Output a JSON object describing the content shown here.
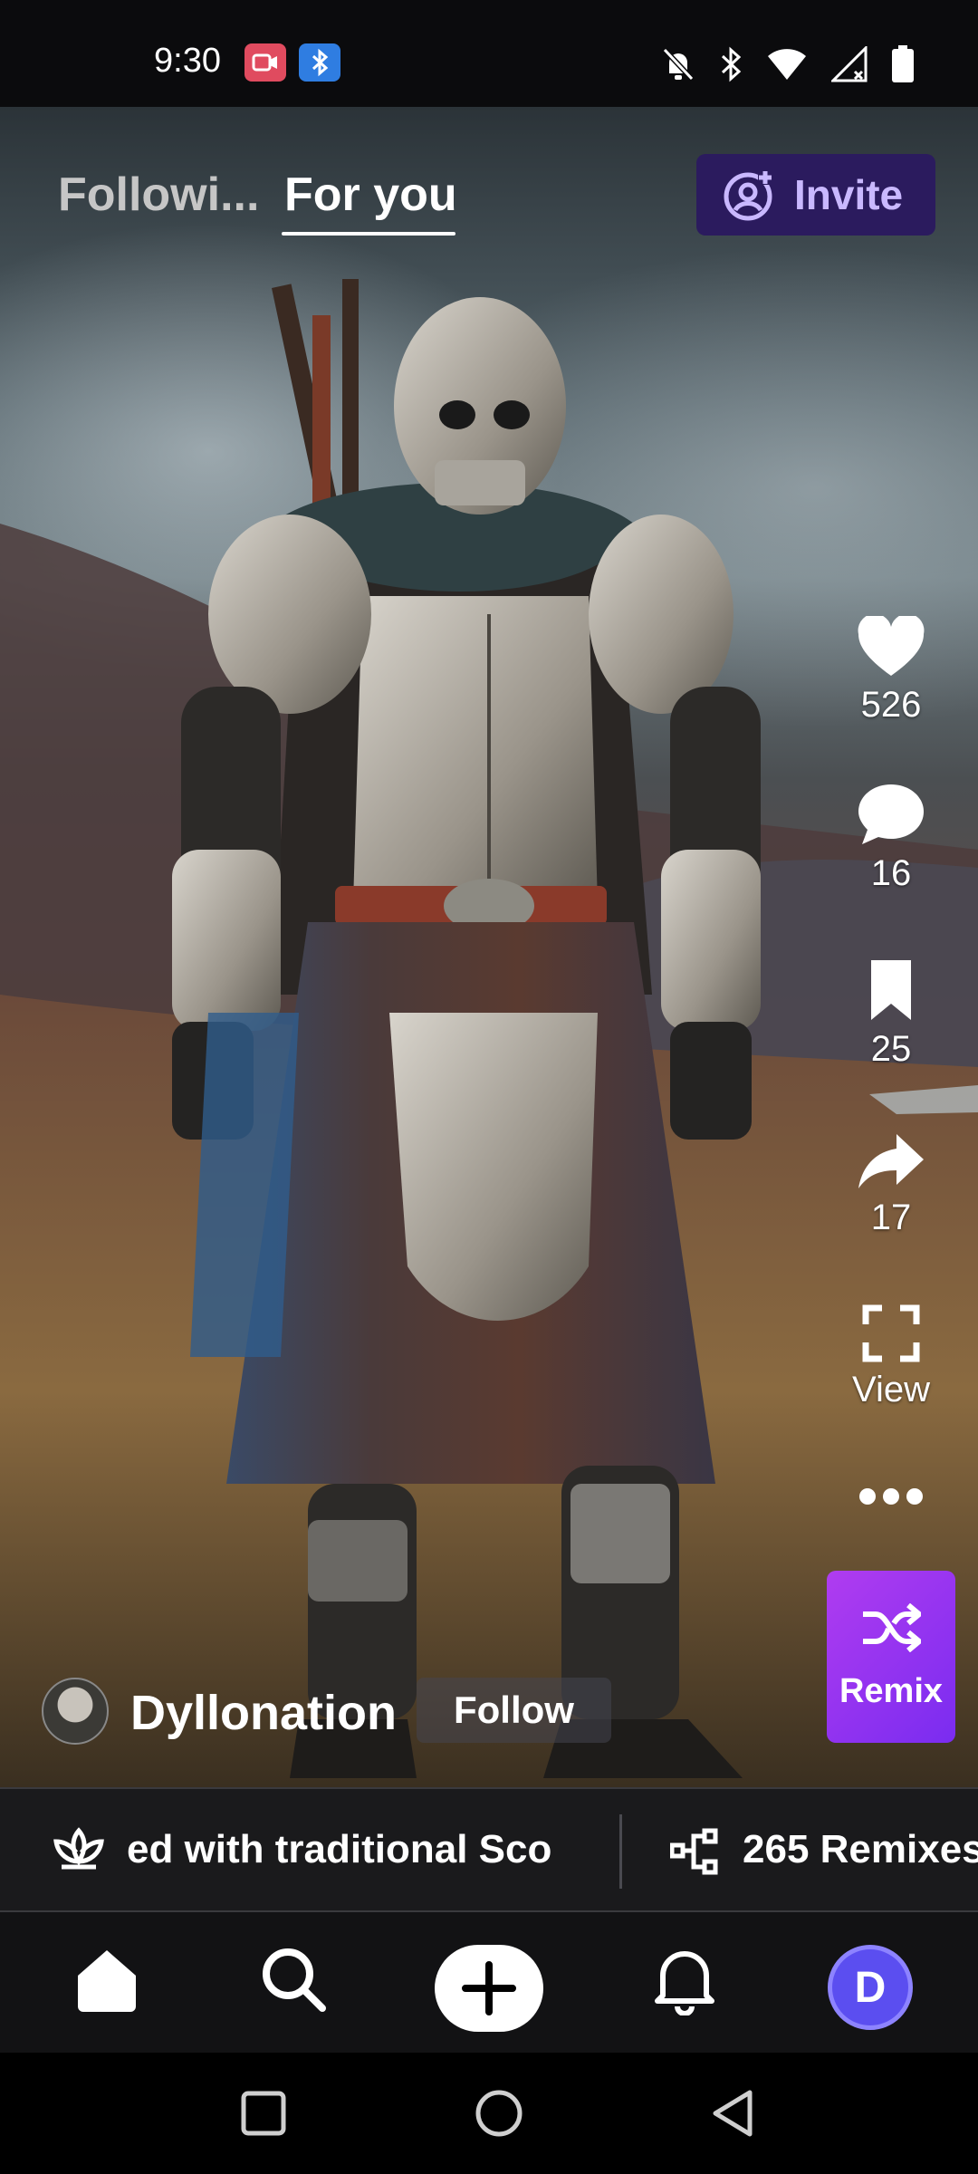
{
  "status_bar": {
    "time": "9:30",
    "icons": [
      "video-record-icon",
      "bluetooth-icon",
      "notifications-off-icon",
      "bluetooth-icon",
      "wifi-icon",
      "signal-icon",
      "battery-icon"
    ]
  },
  "top_tabs": {
    "following_label": "Followi...",
    "for_you_label": "For you",
    "invite_label": "Invite"
  },
  "actions": {
    "likes": "526",
    "comments": "16",
    "saves": "25",
    "shares": "17",
    "view_label": "View",
    "remix_label": "Remix"
  },
  "creator": {
    "name": "Dyllonation",
    "follow_label": "Follow"
  },
  "info_strip": {
    "prompt_text": "ed with traditional Sco",
    "remixes_text": "265 Remixes"
  },
  "bottom_nav": {
    "profile_initial": "D"
  },
  "colors": {
    "invite_bg": "#2b1b5e",
    "invite_text": "#c9b8ff",
    "remix_gradient_start": "#b03cf0",
    "remix_gradient_end": "#7a2cf0",
    "profile_avatar": "#5b4ef0"
  }
}
